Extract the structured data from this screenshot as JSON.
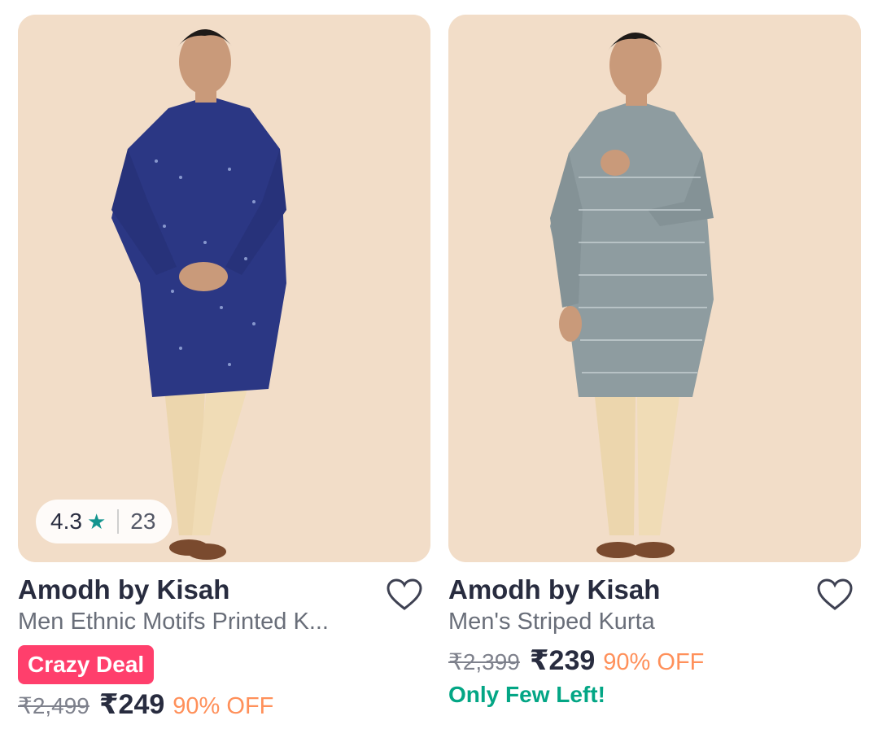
{
  "products": [
    {
      "brand": "Amodh by Kisah",
      "title": "Men Ethnic Motifs Printed K...",
      "rating": "4.3",
      "rating_count": "23",
      "badge": "Crazy Deal",
      "mrp": "₹2,499",
      "price": "₹249",
      "discount": "90% OFF",
      "kurta_color": "#2b3784"
    },
    {
      "brand": "Amodh by Kisah",
      "title": "Men's Striped Kurta",
      "mrp": "₹2,399",
      "price": "₹239",
      "discount": "90% OFF",
      "stock_note": "Only Few Left!",
      "kurta_color": "#8e9ca0"
    }
  ],
  "icons": {
    "rating": "star-icon",
    "wishlist": "heart-outline-icon"
  },
  "colors": {
    "badge": "#ff3f6c",
    "discount": "#ff905a",
    "stock": "#03a685",
    "star": "#14958f"
  }
}
